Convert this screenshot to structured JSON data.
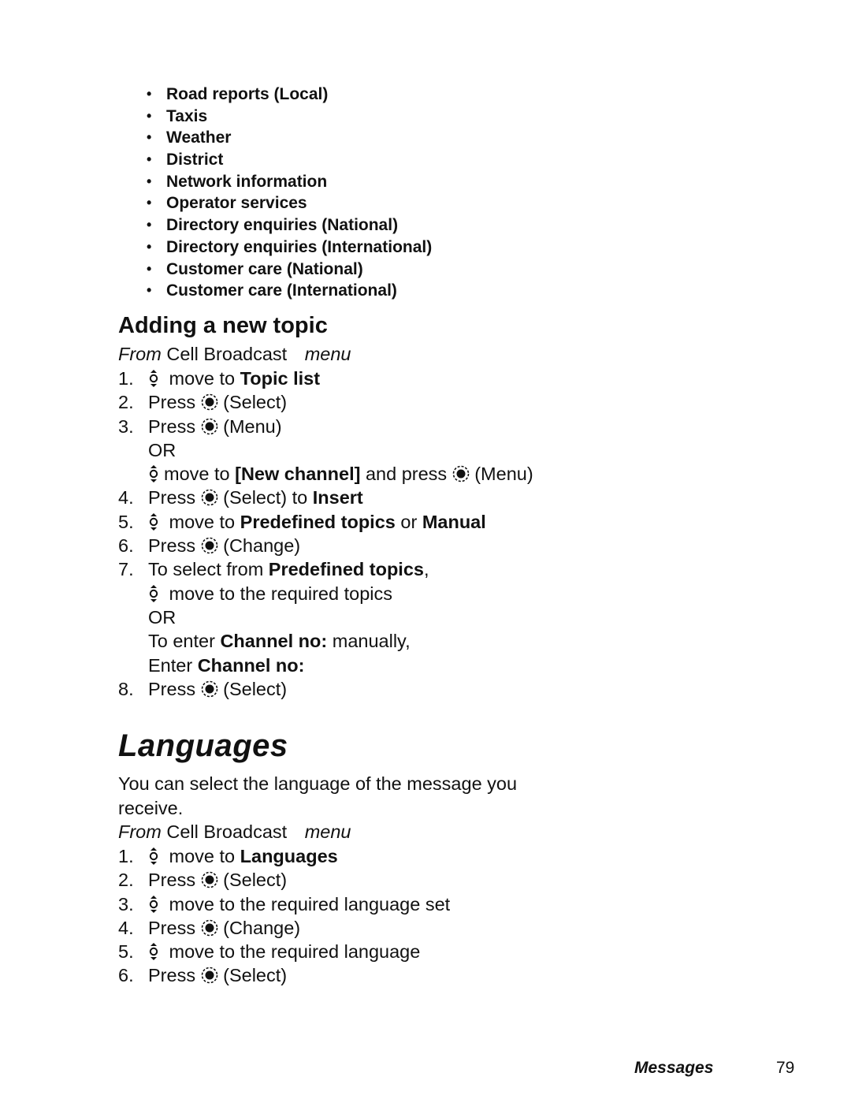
{
  "topic_list": [
    "Road reports (Local)",
    "Taxis",
    "Weather",
    "District",
    "Network information",
    "Operator services",
    "Directory enquiries (National)",
    "Directory enquiries (International)",
    "Customer care (National)",
    "Customer care (International)"
  ],
  "bullet_glyph": "•",
  "adding_topic": {
    "heading": "Adding a new topic",
    "from_prefix": "From",
    "from_menu": "Cell Broadcast",
    "from_suffix": "menu",
    "steps": {
      "s1": {
        "num": "1.",
        "text": "move to ",
        "bold": "Topic list"
      },
      "s2": {
        "num": "2.",
        "pre": "Press ",
        "post": " (Select)"
      },
      "s3": {
        "num": "3.",
        "pre": "Press ",
        "post": " (Menu)",
        "or": "OR",
        "alt_text": "move to ",
        "alt_bold": "[New channel]",
        "alt_mid": " and press ",
        "alt_post": " (Menu)"
      },
      "s4": {
        "num": "4.",
        "pre": "Press ",
        "post": " (Select) to ",
        "bold": "Insert"
      },
      "s5": {
        "num": "5.",
        "text": "move to ",
        "bold1": "Predefined topics",
        "mid": " or ",
        "bold2": "Manual"
      },
      "s6": {
        "num": "6.",
        "pre": "Press ",
        "post": " (Change)"
      },
      "s7": {
        "num": "7.",
        "pre": "To select from ",
        "bold": "Predefined topics",
        "post": ",",
        "line2": "move to the required topics",
        "or": "OR",
        "line4_pre": "To enter ",
        "line4_bold": "Channel no:",
        "line4_post": " manually,",
        "line5_pre": "Enter ",
        "line5_bold": "Channel no:"
      },
      "s8": {
        "num": "8.",
        "pre": "Press ",
        "post": " (Select)"
      }
    }
  },
  "languages": {
    "heading": "Languages",
    "description": "You can select the language of the message you receive.",
    "from_prefix": "From",
    "from_menu": "Cell Broadcast",
    "from_suffix": "menu",
    "steps": {
      "s1": {
        "num": "1.",
        "text": "move to ",
        "bold": "Languages"
      },
      "s2": {
        "num": "2.",
        "pre": "Press ",
        "post": " (Select)"
      },
      "s3": {
        "num": "3.",
        "text": "move to the required language set"
      },
      "s4": {
        "num": "4.",
        "pre": "Press ",
        "post": " (Change)"
      },
      "s5": {
        "num": "5.",
        "text": "move to the required language"
      },
      "s6": {
        "num": "6.",
        "pre": "Press ",
        "post": " (Select)"
      }
    }
  },
  "footer": {
    "section": "Messages",
    "page_number": "79"
  },
  "icons": {
    "navigate": "navigation-key-up-down-icon",
    "select": "center-select-key-icon"
  }
}
